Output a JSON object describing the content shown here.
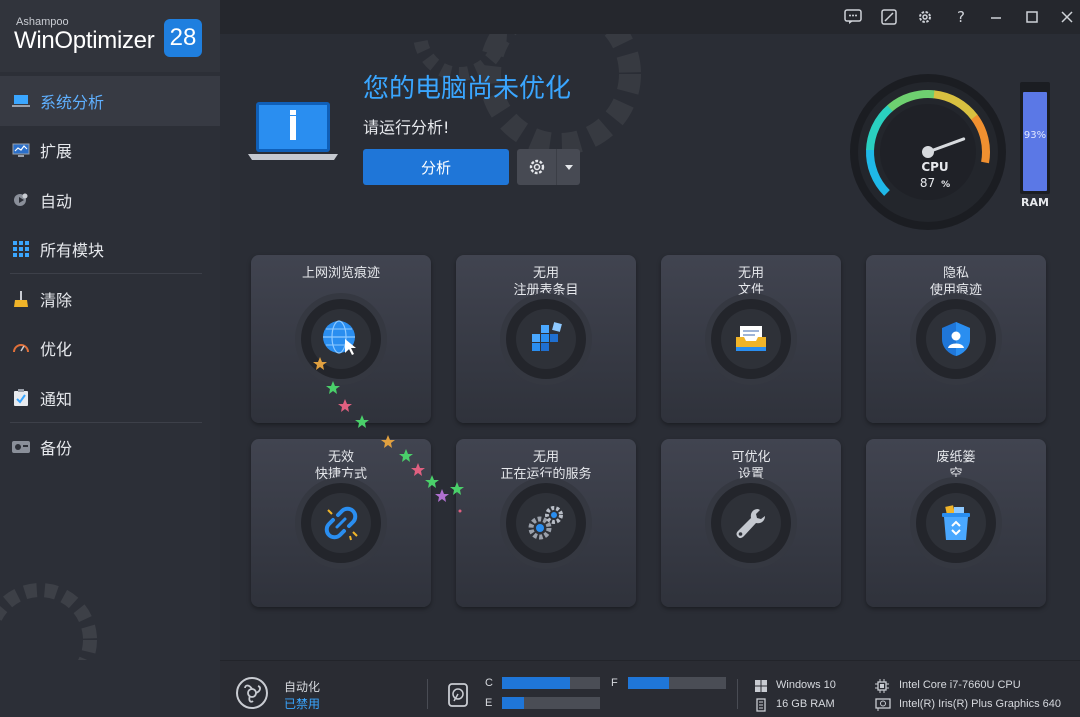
{
  "app": {
    "brand": "Ashampoo",
    "name": "WinOptimizer",
    "version": "28"
  },
  "sidebar": {
    "items": [
      {
        "label": "系统分析",
        "icon": "laptop-icon",
        "active": true
      },
      {
        "label": "扩展",
        "icon": "monitor-chart-icon"
      },
      {
        "label": "自动",
        "icon": "auto-play-icon"
      },
      {
        "label": "所有模块",
        "icon": "grid-icon"
      },
      {
        "label": "清除",
        "icon": "broom-icon"
      },
      {
        "label": "优化",
        "icon": "speedometer-icon"
      },
      {
        "label": "通知",
        "icon": "clipboard-check-icon"
      },
      {
        "label": "备份",
        "icon": "backup-drive-icon"
      }
    ]
  },
  "header": {
    "title": "您的电脑尚未优化",
    "subtitle": "请运行分析!",
    "analyze_label": "分析"
  },
  "gauge": {
    "cpu_label": "CPU",
    "cpu_value": "87",
    "cpu_unit": "%",
    "ram_label": "RAM",
    "ram_value": "93%",
    "ram_fraction": 0.93
  },
  "tiles": [
    {
      "line1": "上网浏览痕迹",
      "line2": "",
      "icon": "globe-icon"
    },
    {
      "line1": "无用",
      "line2": "注册表条目",
      "icon": "registry-blocks-icon"
    },
    {
      "line1": "无用",
      "line2": "文件",
      "icon": "file-tray-icon"
    },
    {
      "line1": "隐私",
      "line2": "使用痕迹",
      "icon": "privacy-shield-icon"
    },
    {
      "line1": "无效",
      "line2": "快捷方式",
      "icon": "broken-link-icon"
    },
    {
      "line1": "无用",
      "line2": "正在运行的服务",
      "icon": "gears-icon"
    },
    {
      "line1": "可优化",
      "line2": "设置",
      "icon": "wrench-icon"
    },
    {
      "line1": "废纸篓",
      "line2": "空",
      "icon": "recycle-bin-icon"
    }
  ],
  "status": {
    "automation_label": "自动化",
    "automation_state": "已禁用",
    "drives": [
      {
        "letter": "C",
        "fraction": 0.69
      },
      {
        "letter": "E",
        "fraction": 0.22
      },
      {
        "letter": "F",
        "fraction": 0.42
      }
    ],
    "os": "Windows 10",
    "ram": "16 GB RAM",
    "cpu": "Intel Core i7-7660U CPU",
    "gpu": "Intel(R) Iris(R) Plus Graphics 640"
  },
  "colors": {
    "accent": "#3aa6ff",
    "button": "#1f76d8",
    "sidebar": "#2c2f37",
    "background": "#2a2d35"
  }
}
